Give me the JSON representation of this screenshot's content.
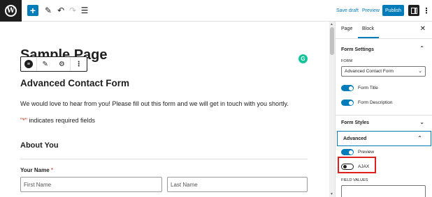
{
  "toolbar": {
    "logo_letter": "W",
    "add_symbol": "+",
    "pen_symbol": "✎",
    "undo_symbol": "↶",
    "redo_symbol": "↷",
    "list_symbol": "☰",
    "save_draft": "Save draft",
    "preview": "Preview",
    "publish": "Publish",
    "more_symbol": "⋮"
  },
  "canvas": {
    "page_title": "Sample Page",
    "block_toolbar": {
      "form_icon_letter": "≡",
      "pen_symbol": "✎",
      "gear_symbol": "⚙",
      "more_symbol": "⋮"
    },
    "grammarly_letter": "G",
    "form_title": "Advanced Contact Form",
    "form_description": "We would love to hear from you! Please fill out this form and we will get in touch with you shortly.",
    "required_star": "\"*\"",
    "required_text": " indicates required fields",
    "section_title": "About You",
    "field_label": "Your Name",
    "field_star": "*",
    "first_name_placeholder": "First Name",
    "last_name_placeholder": "Last Name"
  },
  "sidebar": {
    "tab_page": "Page",
    "tab_block": "Block",
    "close_symbol": "✕",
    "form_settings": {
      "title": "Form Settings",
      "form_label": "FORM",
      "form_selected": "Advanced Contact Form",
      "toggle_form_title": "Form Title",
      "toggle_form_description": "Form Description"
    },
    "form_styles": {
      "title": "Form Styles"
    },
    "advanced": {
      "title": "Advanced",
      "toggle_preview": "Preview",
      "toggle_ajax": "AJAX",
      "field_values_label": "FIELD VALUES"
    },
    "chevron_up": "⌃",
    "chevron_down": "⌄"
  },
  "states": {
    "form_title_toggle": true,
    "form_description_toggle": true,
    "preview_toggle": true,
    "ajax_toggle": false
  },
  "colors": {
    "accent": "#007cba",
    "highlight": "#e02020",
    "required": "#c02b0a"
  }
}
